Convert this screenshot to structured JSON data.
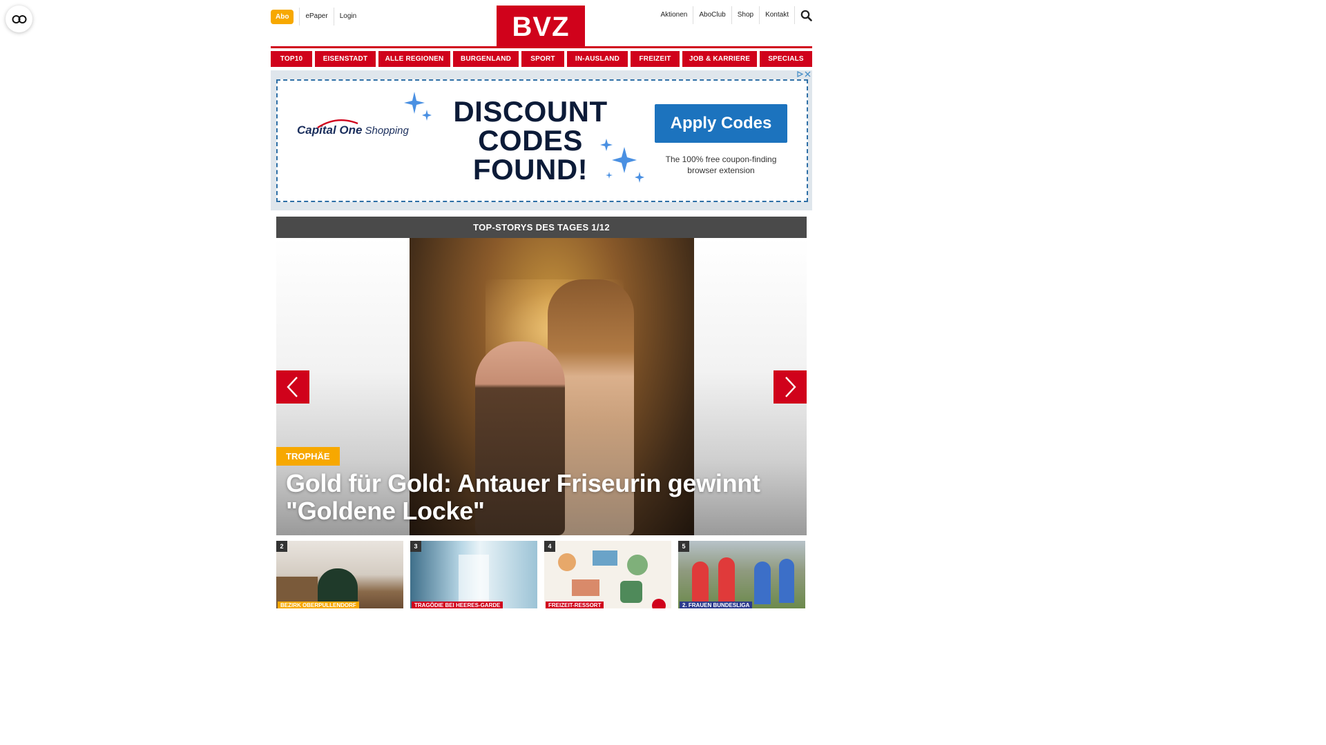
{
  "header": {
    "abo_label": "Abo",
    "left_links": [
      "ePaper",
      "Login"
    ],
    "logo_text": "BVZ",
    "right_links": [
      "Aktionen",
      "AboClub",
      "Shop",
      "Kontakt"
    ]
  },
  "nav": {
    "items": [
      "TOP10",
      "EISENSTADT",
      "ALLE REGIONEN",
      "BURGENLAND",
      "SPORT",
      "IN-AUSLAND",
      "FREIZEIT",
      "JOB & KARRIERE",
      "SPECIALS"
    ]
  },
  "ad": {
    "brand": "Capital One",
    "brand_suffix": "Shopping",
    "headline_lines": [
      "DISCOUNT",
      "CODES",
      "FOUND!"
    ],
    "cta_label": "Apply Codes",
    "cta_sub": "The 100% free coupon-finding browser extension"
  },
  "top_stories": {
    "bar_title": "TOP-STORYS DES TAGES 1/12",
    "hero": {
      "badge": "TROPHÄE",
      "headline": "Gold für Gold: Antauer Friseurin gewinnt \"Goldene Locke\""
    },
    "thumbs": [
      {
        "num": "2",
        "tag": "BEZIRK OBERPULLENDORF"
      },
      {
        "num": "3",
        "tag": "TRAGÖDIE BEI HEERES-GARDE"
      },
      {
        "num": "4",
        "tag": "FREIZEIT-RESSORT"
      },
      {
        "num": "5",
        "tag": "2. FRAUEN BUNDESLIGA"
      }
    ]
  },
  "colors": {
    "brand_red": "#d0021b",
    "accent_yellow": "#f7a800",
    "cta_blue": "#1c73be",
    "bar_grey": "#4a4a4a"
  },
  "icons": [
    "accessibility-toggle-icon",
    "search-icon",
    "chevron-left-icon",
    "chevron-right-icon",
    "adchoices-icon",
    "ad-close-icon",
    "sparkle-icon"
  ]
}
